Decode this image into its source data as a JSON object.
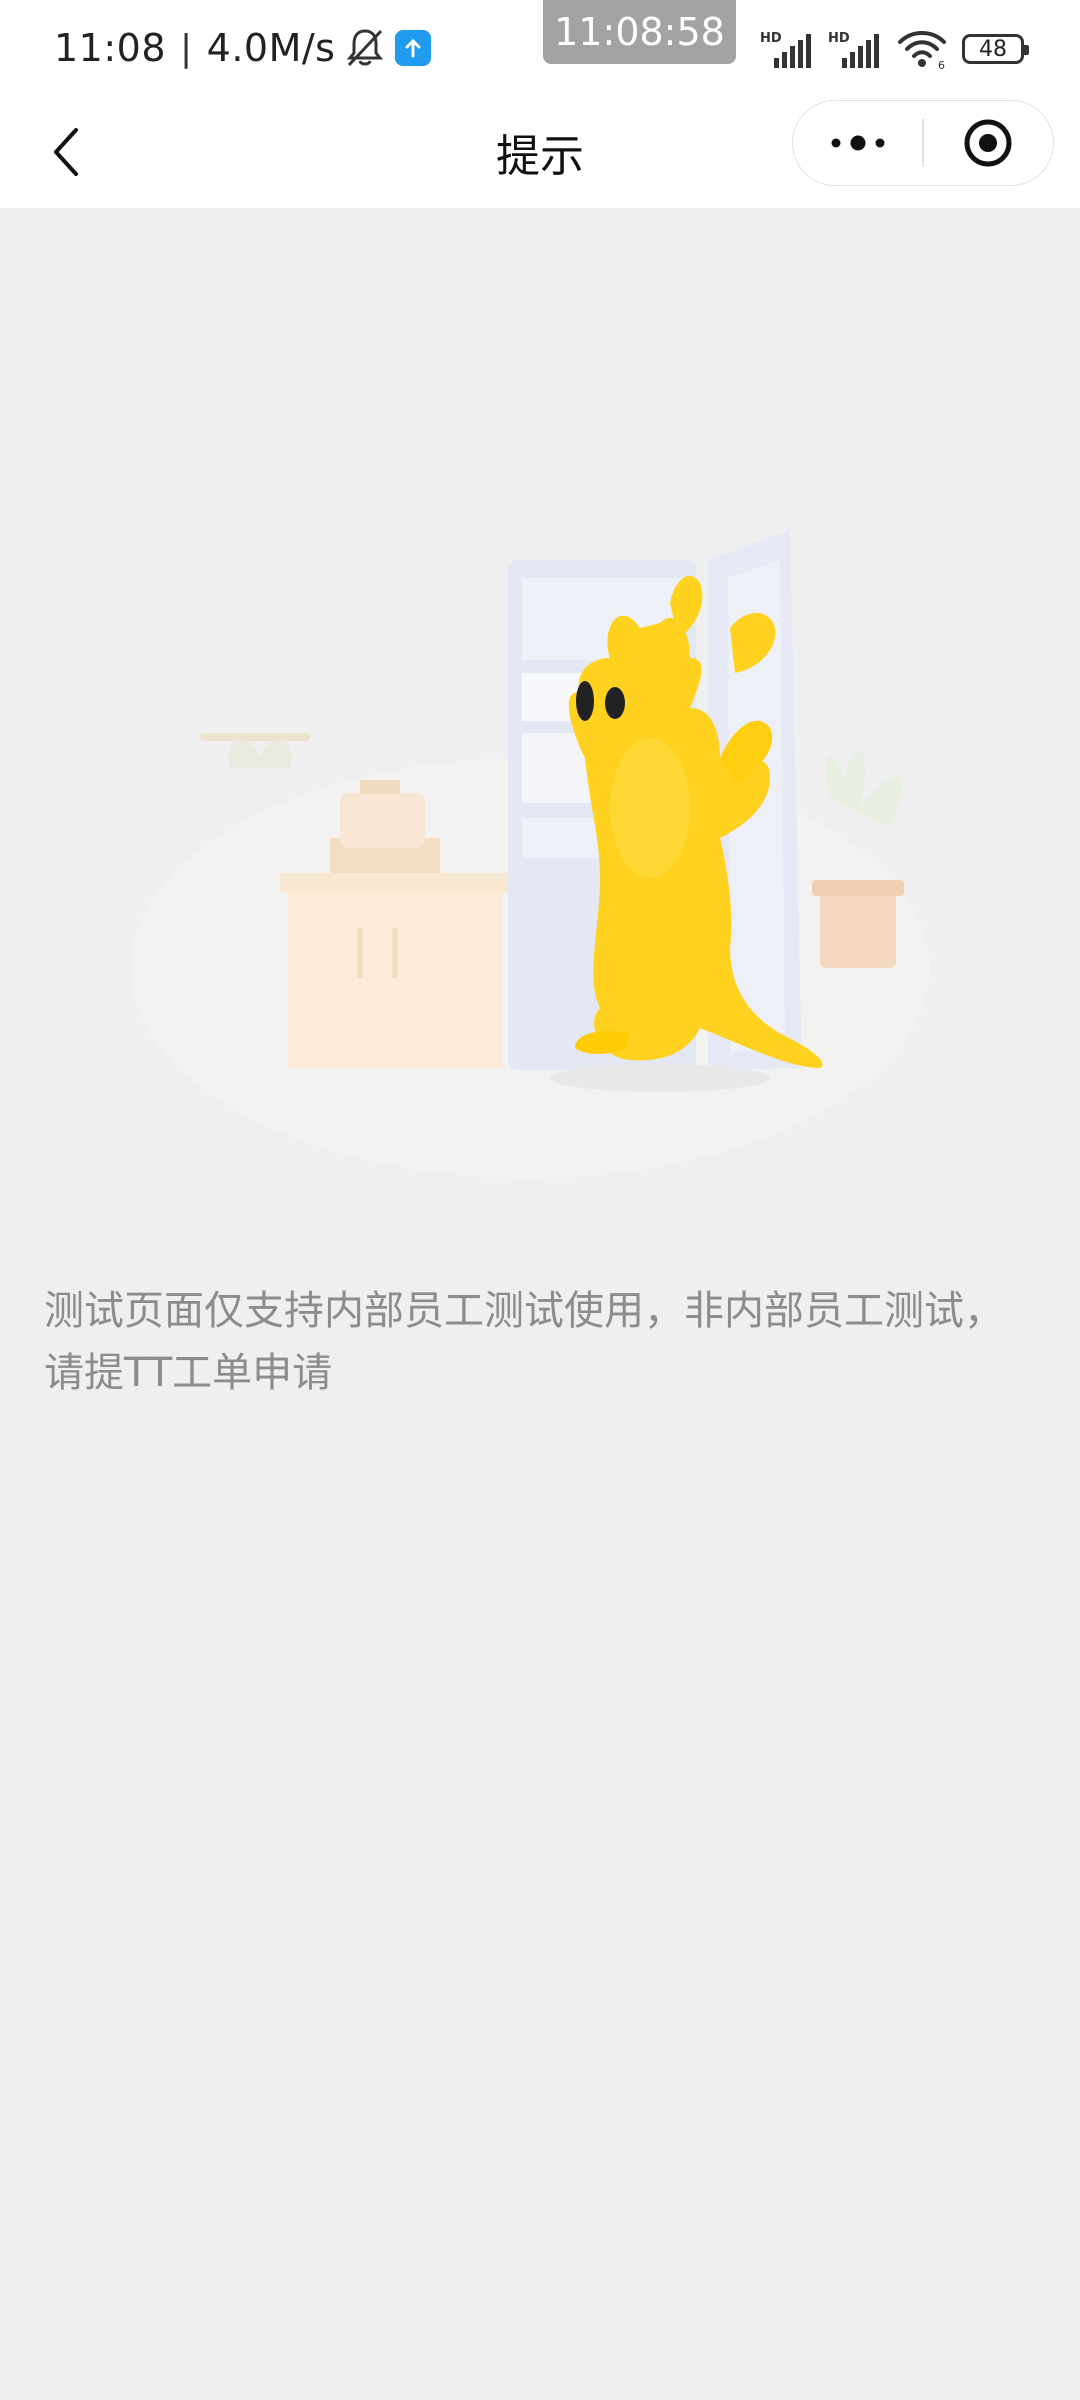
{
  "status_bar": {
    "time": "11:08",
    "separator": "|",
    "net_speed": "4.0M/s",
    "clock_overlay": "11:08:58",
    "signal1_label": "HD",
    "signal2_label": "HD",
    "wifi_label": "6",
    "battery": "48",
    "icons": [
      "bell-muted-icon",
      "app-upload-icon",
      "signal-icon",
      "signal-icon",
      "wifi-icon",
      "battery-icon"
    ]
  },
  "nav": {
    "title": "提示",
    "back_icon": "chevron-left-icon",
    "more_icon": "more-dots-icon",
    "close_icon": "target-circle-icon"
  },
  "main": {
    "illustration": "kangaroo-kitchen-illustration",
    "message": "测试页面仅支持内部员工测试使用，非内部员工测试，请提TT工单申请"
  },
  "colors": {
    "page_bg": "#efefef",
    "bar_bg": "#ffffff",
    "message_text": "#8c8c8c",
    "kangaroo": "#ffd21f",
    "app_badge": "#1f9bf0"
  }
}
